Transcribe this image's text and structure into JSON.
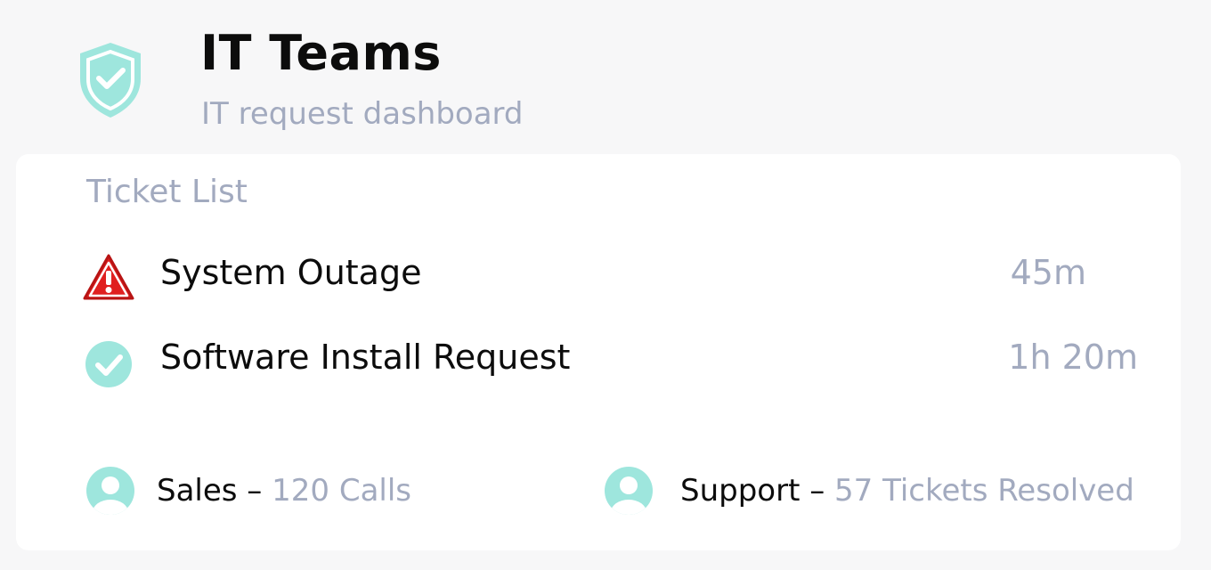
{
  "header": {
    "title": "IT Teams",
    "subtitle": "IT request dashboard",
    "icon": "shield-check-icon"
  },
  "tickets": {
    "section_title": "Ticket List",
    "items": [
      {
        "label": "System Outage",
        "time": "45m",
        "icon": "warning-icon",
        "status": "alert"
      },
      {
        "label": "Software Install Request",
        "time": "1h 20m",
        "icon": "check-circle-icon",
        "status": "done"
      }
    ]
  },
  "teams": [
    {
      "name": "Sales",
      "separator": " – ",
      "value": "120 Calls",
      "icon": "avatar-icon"
    },
    {
      "name": "Support",
      "separator": " – ",
      "value": "57 Tickets Resolved",
      "icon": "avatar-icon"
    }
  ],
  "colors": {
    "accent": "#9ee6dd",
    "alert": "#e02020",
    "muted_text": "#a2aabf",
    "primary_text": "#0c0c0c",
    "background": "#f7f7f8",
    "card": "#ffffff"
  }
}
